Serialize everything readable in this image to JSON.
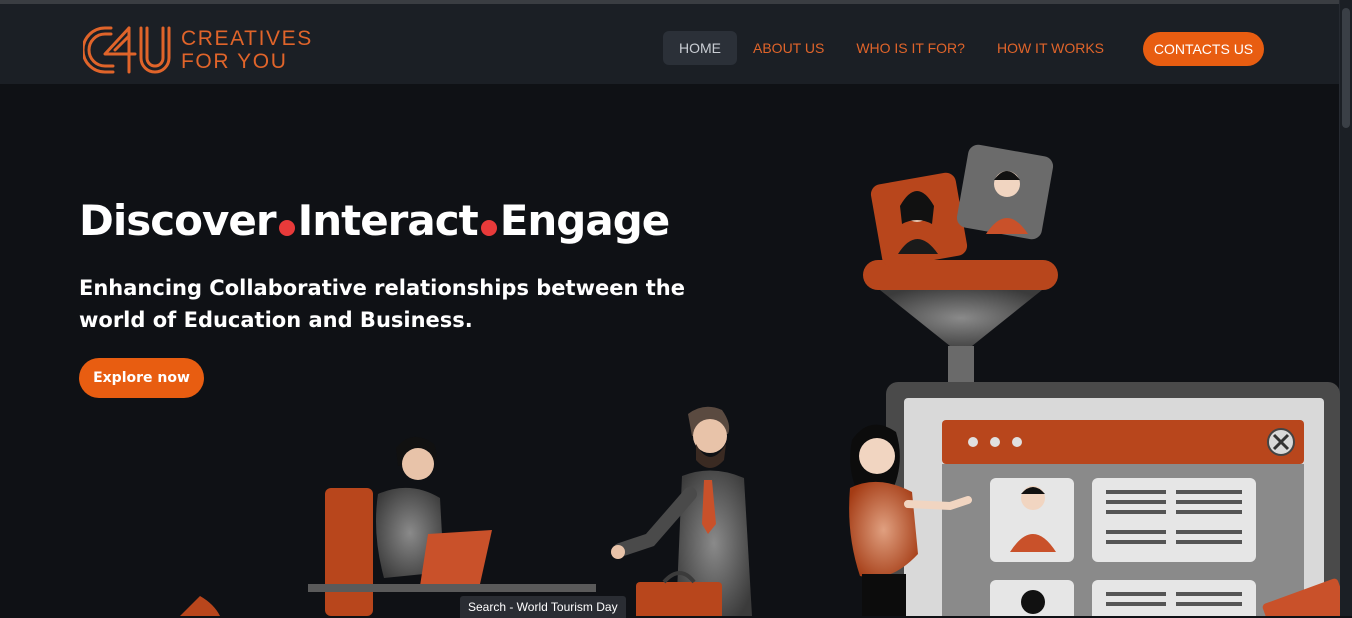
{
  "brand": {
    "name_line1": "CREATIVES",
    "name_line2": "FOR YOU",
    "logo_mark": "C4U"
  },
  "nav": {
    "items": [
      {
        "label": "HOME",
        "active": true
      },
      {
        "label": "ABOUT US",
        "active": false
      },
      {
        "label": "WHO IS IT FOR?",
        "active": false
      },
      {
        "label": "HOW IT WORKS",
        "active": false
      }
    ],
    "cta": "CONTACTS US"
  },
  "hero": {
    "title_words": [
      "Discover",
      "Interact",
      "Engage"
    ],
    "subtitle": "Enhancing Collaborative relationships between the world of Education and Business.",
    "button": "Explore now"
  },
  "tooltip": "Search - World Tourism Day",
  "colors": {
    "accent": "#e85d11",
    "background": "#0f1115",
    "navbar": "#1b1f25",
    "dot": "#e83a3a"
  },
  "icons": [
    "close-icon",
    "avatar-icon"
  ]
}
